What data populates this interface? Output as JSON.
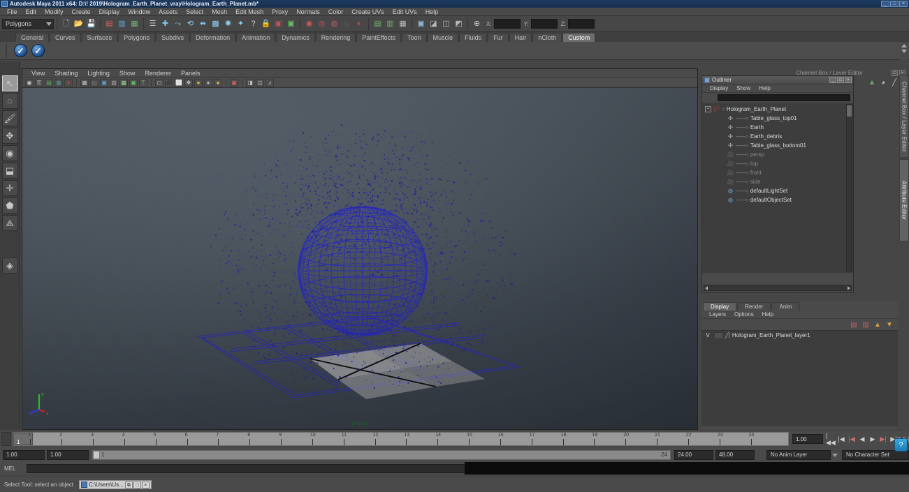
{
  "window": {
    "title": "Autodesk Maya 2011 x64: D:\\! 2019\\Hologram_Earth_Planet_vray\\Hologram_Earth_Planet.mb*",
    "buttons": [
      "_",
      "□",
      "×"
    ]
  },
  "menubar": {
    "items": [
      "File",
      "Edit",
      "Modify",
      "Create",
      "Display",
      "Window",
      "Assets",
      "Select",
      "Mesh",
      "Edit Mesh",
      "Proxy",
      "Normals",
      "Color",
      "Create UVs",
      "Edit UVs",
      "Help"
    ]
  },
  "toolbar": {
    "menuset": "Polygons",
    "coord_labels": {
      "x": "X:",
      "y": "Y:",
      "z": "Z:"
    },
    "coord_values": {
      "x": "",
      "y": "",
      "z": ""
    },
    "icons": [
      "new-scene-icon",
      "open-scene-icon",
      "save-scene-icon",
      "undo-icon",
      "redo-icon",
      "rebuild-icon",
      "select-hierarchy-icon",
      "add-icon",
      "curve-snap-icon",
      "point-snap-icon",
      "grid-snap-icon",
      "view-plane-icon",
      "magnet-icon",
      "construction-plane-icon",
      "make-live-icon",
      "help-icon",
      "lock-icon",
      "render-icon",
      "render-view-icon",
      "ipr-render-icon",
      "render-globals-icon",
      "render-settings-icon",
      "hypershade-icon",
      "render-region-icon",
      "open-render-view-icon",
      "show-manip-icon",
      "toggle-icon",
      "channel-box-toggle-icon",
      "attribute-editor-toggle-icon",
      "tool-settings-toggle-icon"
    ]
  },
  "shelf": {
    "tabs": [
      "General",
      "Curves",
      "Surfaces",
      "Polygons",
      "Subdivs",
      "Deformation",
      "Animation",
      "Dynamics",
      "Rendering",
      "PaintEffects",
      "Toon",
      "Muscle",
      "Fluids",
      "Fur",
      "Hair",
      "nCloth",
      "Custom"
    ],
    "active_tab": "Custom",
    "buttons": [
      "check-blue-icon",
      "check-blue-icon"
    ]
  },
  "toolbox": {
    "tools": [
      {
        "name": "select-tool",
        "glyph": "↖",
        "active": true
      },
      {
        "name": "lasso-tool",
        "glyph": "◌",
        "active": false
      },
      {
        "name": "paint-select-tool",
        "glyph": "🖌",
        "active": false
      },
      {
        "name": "move-tool",
        "glyph": "✥",
        "active": false
      },
      {
        "name": "rotate-tool",
        "glyph": "◉",
        "active": false
      },
      {
        "name": "scale-tool",
        "glyph": "⬓",
        "active": false
      },
      {
        "name": "universal-manip-tool",
        "glyph": "✛",
        "active": false
      },
      {
        "name": "soft-mod-tool",
        "glyph": "⬟",
        "active": false
      },
      {
        "name": "show-manip-tool",
        "glyph": "⟁",
        "active": false
      },
      {
        "name": "last-tool",
        "glyph": "",
        "active": false
      },
      {
        "name": "spacer",
        "glyph": "",
        "active": false
      },
      {
        "name": "layout-preset-tool",
        "glyph": "◈",
        "active": false
      }
    ]
  },
  "viewport": {
    "menus": [
      "View",
      "Shading",
      "Lighting",
      "Show",
      "Renderer",
      "Panels"
    ],
    "camera_label": "persp",
    "axis_labels": {
      "x": "x",
      "y": "y",
      "z": "z"
    },
    "icons": [
      "select-camera-icon",
      "lock-camera-icon",
      "book-icon",
      "ipr-icon",
      "keyframe-icon",
      "grid-toggle-icon",
      "film-gate-icon",
      "resolution-gate-icon",
      "field-chart-icon",
      "safe-action-icon",
      "safe-title-icon",
      "text-icon",
      "wireframe-icon",
      "smooth-shade-icon",
      "flat-shade-icon",
      "shaded-wire-icon",
      "light-one-icon",
      "light-default-icon",
      "light-all-icon",
      "xray-icon",
      "isolate-select-icon",
      "frame-all-icon",
      "share-icon"
    ],
    "scene": {
      "sphere": "Earth wireframe globe",
      "debris": "Earth_debris particle cloud",
      "table_glass": "Table glass wireframe plane",
      "grid": "center grid plane"
    }
  },
  "channelbox": {
    "header": "Channel Box / Layer Editor",
    "window_buttons": [
      "□",
      "×"
    ],
    "icons": [
      "channel-box-icon",
      "clock-icon",
      "pencil-icon"
    ]
  },
  "outliner": {
    "title": "Outliner",
    "window_buttons": [
      "_",
      "□",
      "×"
    ],
    "menus": [
      "Display",
      "Show",
      "Help"
    ],
    "search_value": "",
    "items": [
      {
        "label": "Hologram_Earth_Planet",
        "icon": "group-icon",
        "level": 0,
        "dim": false,
        "expander": "−"
      },
      {
        "label": "Table_glass_top01",
        "icon": "transform-icon",
        "level": 1,
        "dim": false,
        "expander": ""
      },
      {
        "label": "Earth",
        "icon": "transform-icon",
        "level": 1,
        "dim": false,
        "expander": ""
      },
      {
        "label": "Earth_debris",
        "icon": "transform-icon",
        "level": 1,
        "dim": false,
        "expander": ""
      },
      {
        "label": "Table_glass_bottom01",
        "icon": "transform-icon",
        "level": 1,
        "dim": false,
        "expander": ""
      },
      {
        "label": "persp",
        "icon": "camera-icon",
        "level": 1,
        "dim": true,
        "expander": ""
      },
      {
        "label": "top",
        "icon": "camera-icon",
        "level": 1,
        "dim": true,
        "expander": ""
      },
      {
        "label": "front",
        "icon": "camera-icon",
        "level": 1,
        "dim": true,
        "expander": ""
      },
      {
        "label": "side",
        "icon": "camera-icon",
        "level": 1,
        "dim": true,
        "expander": ""
      },
      {
        "label": "defaultLightSet",
        "icon": "set-icon",
        "level": 1,
        "dim": false,
        "expander": ""
      },
      {
        "label": "defaultObjectSet",
        "icon": "set-icon",
        "level": 1,
        "dim": false,
        "expander": ""
      }
    ]
  },
  "layer_editor": {
    "tabs": [
      "Display",
      "Render",
      "Anim"
    ],
    "active_tab": "Display",
    "menus": [
      "Layers",
      "Options",
      "Help"
    ],
    "tool_icons": [
      "new-layer-icon",
      "new-layer-selected-icon",
      "layer-up-icon",
      "layer-down-icon"
    ],
    "layers": [
      {
        "visibility": "V",
        "display_type": "",
        "name": "Hologram_Earth_Planet_layer1"
      }
    ]
  },
  "right_tabs": {
    "items": [
      "Channel Box / Layer Editor",
      "Attribute Editor"
    ],
    "active": "Attribute Editor"
  },
  "timeline": {
    "current_frame": "1",
    "ticks": [
      "1",
      "2",
      "3",
      "4",
      "5",
      "6",
      "7",
      "8",
      "9",
      "10",
      "11",
      "12",
      "13",
      "14",
      "15",
      "16",
      "17",
      "18",
      "19",
      "20",
      "21",
      "22",
      "23",
      "24"
    ],
    "current_field": "1.00",
    "playback_buttons": [
      {
        "name": "go-to-start-button",
        "glyph": "|◀◀"
      },
      {
        "name": "step-back-keyframe-button",
        "glyph": "|◀"
      },
      {
        "name": "step-back-frame-button",
        "glyph": "|◀"
      },
      {
        "name": "play-backwards-button",
        "glyph": "◀"
      },
      {
        "name": "play-forwards-button",
        "glyph": "▶"
      },
      {
        "name": "step-forward-frame-button",
        "glyph": "▶|"
      },
      {
        "name": "step-forward-keyframe-button",
        "glyph": "▶|"
      },
      {
        "name": "go-to-end-button",
        "glyph": "▶▶|"
      }
    ]
  },
  "range": {
    "start_field": "1.00",
    "end_field": "1.00",
    "range_start_label": "1",
    "range_end_label": "24",
    "playback_start": "24.00",
    "playback_end": "48.00",
    "anim_layer": "No Anim Layer",
    "character_set": "No Character Set"
  },
  "command_line": {
    "label": "MEL",
    "value": ""
  },
  "status": {
    "text": "Select Tool: select an object",
    "taskbar_item": "C:\\Users\\Us...",
    "taskbar_buttons": [
      "⧉",
      "□",
      "×"
    ],
    "help_button": "?"
  },
  "colors": {
    "title_bar": "#1f3a5f",
    "panel_bg": "#4a4a4a",
    "viewport_top": "#67727d",
    "viewport_bottom": "#343b44",
    "wireframe_blue": "#2b2bb5",
    "persp_green": "#1d5e2a",
    "accent_blue": "#3aa9e0"
  }
}
